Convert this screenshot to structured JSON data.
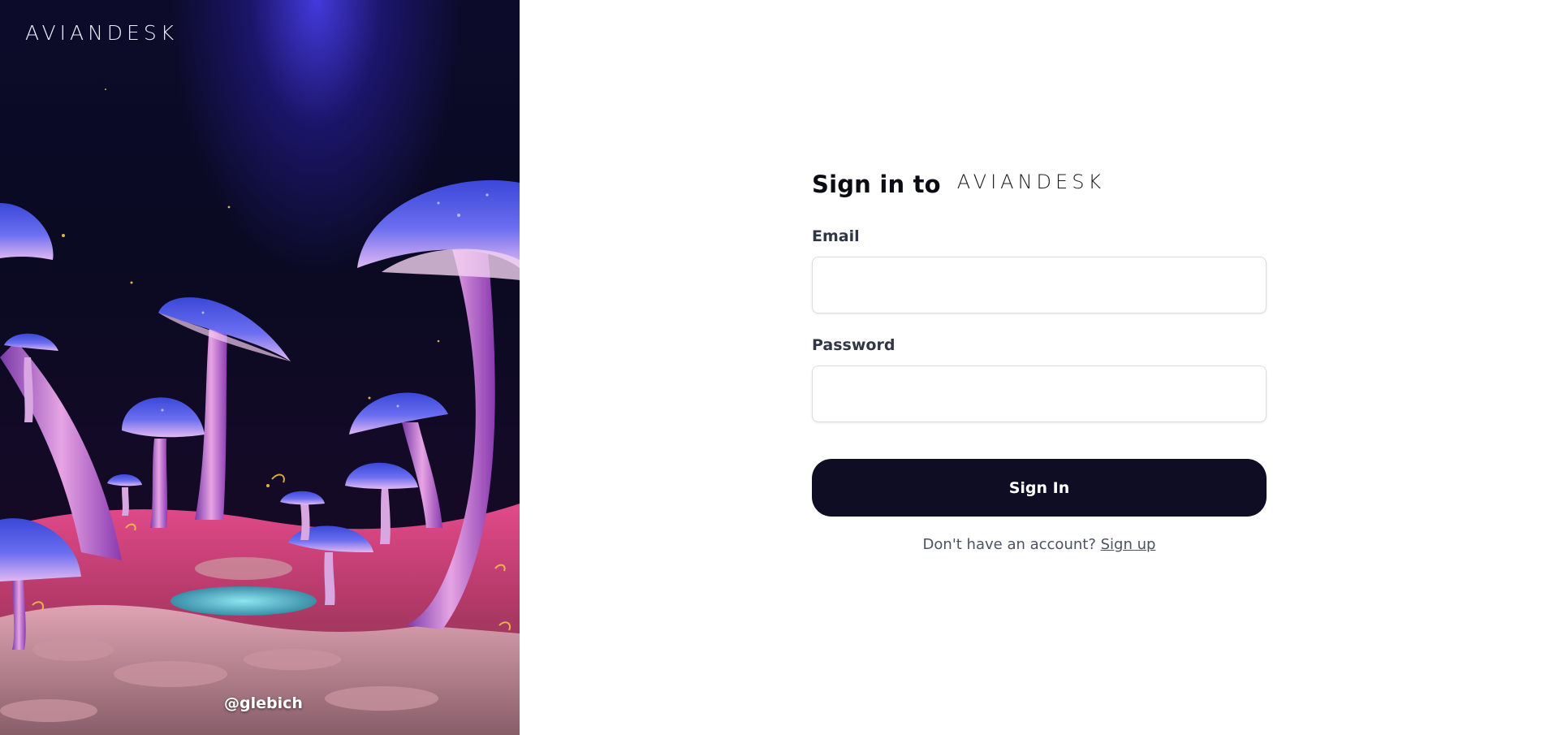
{
  "hero": {
    "logo_text": "AVIANDESK",
    "credit": "@glebich",
    "image_subject": "glowing-mushroom-forest-illustration"
  },
  "signin": {
    "title": "Sign in to",
    "brand": "AVIANDESK",
    "email_label": "Email",
    "email_value": "",
    "password_label": "Password",
    "password_value": "",
    "submit_label": "Sign In",
    "signup_prompt": "Don't have an account?",
    "signup_link": "Sign up"
  },
  "colors": {
    "button_bg": "#0f0d24",
    "label_text": "#2f3645",
    "hero_glow": "#463ce6",
    "mushroom_cap": "#4a5ee0",
    "mushroom_stem": "#d88ad4",
    "ground": "#d63c7a"
  }
}
